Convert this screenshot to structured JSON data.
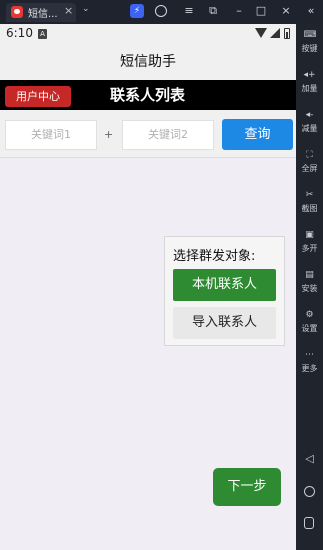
{
  "host": {
    "tab_title": "短信...",
    "close_glyph": "×",
    "chevron_glyph": "⌄"
  },
  "status": {
    "time": "6:10",
    "sim_badge": "A"
  },
  "app": {
    "title": "短信助手"
  },
  "header": {
    "user_center_label": "用户中心",
    "page_heading": "联系人列表"
  },
  "search": {
    "keyword1_placeholder": "关键词1",
    "keyword2_placeholder": "关键词2",
    "plus": "+",
    "query_label": "查询"
  },
  "panel": {
    "label": "选择群发对象:",
    "local_contacts_label": "本机联系人",
    "import_contacts_label": "导入联系人"
  },
  "next_label": "下一步",
  "sidebar": {
    "items": [
      {
        "label": "按键",
        "icon": "keyboard-icon"
      },
      {
        "label": "加量",
        "icon": "volume-up-icon"
      },
      {
        "label": "减量",
        "icon": "volume-down-icon"
      },
      {
        "label": "全屏",
        "icon": "fullscreen-icon"
      },
      {
        "label": "截图",
        "icon": "scissors-icon"
      },
      {
        "label": "多开",
        "icon": "multi-instance-icon"
      },
      {
        "label": "安装",
        "icon": "install-icon"
      },
      {
        "label": "设置",
        "icon": "settings-icon"
      },
      {
        "label": "更多",
        "icon": "more-icon"
      }
    ]
  },
  "colors": {
    "accent_blue": "#1e88e5",
    "accent_green": "#2e8b32",
    "accent_red": "#c62828",
    "header_black": "#000000"
  }
}
